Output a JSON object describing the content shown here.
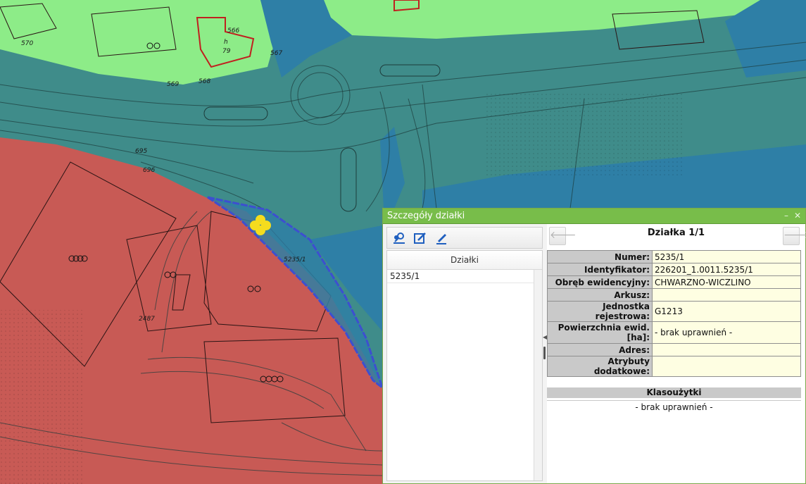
{
  "map": {
    "labels": {
      "n570": "570",
      "n566": "566",
      "n79": "79",
      "nh": "h",
      "n567": "567",
      "n569": "569",
      "n568": "568",
      "n695": "695",
      "n696": "696",
      "n2487": "2487",
      "parcel": "5235/1"
    },
    "colors": {
      "green": "#8dec88",
      "teal": "#3f8c8a",
      "blue": "#2e7fa6",
      "red": "#c85a55",
      "parcel_outline": "#3d4fd0",
      "marker": "#f5dc1e"
    }
  },
  "dialog": {
    "title": "Szczegóły działki",
    "minimize_glyph": "–",
    "close_glyph": "✕",
    "toolbar": {
      "icons": [
        "locate-parcel-icon",
        "edit-form-icon",
        "pencil-icon"
      ]
    },
    "list": {
      "header": "Działki",
      "items": [
        "5235/1"
      ]
    },
    "nav": {
      "prev_glyph": "🡐",
      "next_glyph": "🡒",
      "title": "Działka 1/1"
    },
    "attributes": [
      {
        "key": "Numer:",
        "value": "5235/1"
      },
      {
        "key": "Identyfikator:",
        "value": "226201_1.0011.5235/1"
      },
      {
        "key": "Obręb ewidencyjny:",
        "value": "CHWARZNO-WICZLINO"
      },
      {
        "key": "Arkusz:",
        "value": ""
      },
      {
        "key": "Jednostka rejestrowa:",
        "value": "G1213"
      },
      {
        "key": "Powierzchnia ewid. [ha]:",
        "value": "- brak uprawnień -"
      },
      {
        "key": "Adres:",
        "value": ""
      },
      {
        "key": "Atrybuty dodatkowe:",
        "value": ""
      }
    ],
    "klasouzytki": {
      "header": "Klasoużytki",
      "note": "- brak uprawnień -"
    }
  }
}
